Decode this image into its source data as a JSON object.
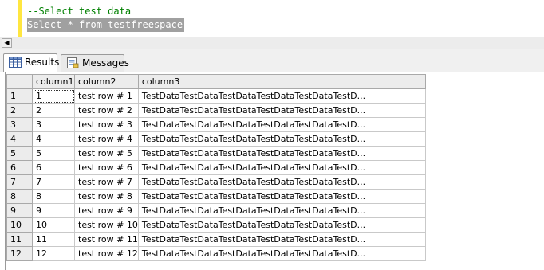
{
  "editor": {
    "comment_line": "--Select test data",
    "selected_line": "Select * from testfreespace"
  },
  "tabs": [
    {
      "label": "Results",
      "icon": "grid-icon",
      "active": true
    },
    {
      "label": "Messages",
      "icon": "messages-icon",
      "active": false
    }
  ],
  "grid": {
    "columns": [
      "column1",
      "column2",
      "column3"
    ],
    "rows": [
      [
        "1",
        "1",
        "test row # 1",
        "TestDataTestDataTestDataTestDataTestDataTestD..."
      ],
      [
        "2",
        "2",
        "test row # 2",
        "TestDataTestDataTestDataTestDataTestDataTestD..."
      ],
      [
        "3",
        "3",
        "test row # 3",
        "TestDataTestDataTestDataTestDataTestDataTestD..."
      ],
      [
        "4",
        "4",
        "test row # 4",
        "TestDataTestDataTestDataTestDataTestDataTestD..."
      ],
      [
        "5",
        "5",
        "test row # 5",
        "TestDataTestDataTestDataTestDataTestDataTestD..."
      ],
      [
        "6",
        "6",
        "test row # 6",
        "TestDataTestDataTestDataTestDataTestDataTestD..."
      ],
      [
        "7",
        "7",
        "test row # 7",
        "TestDataTestDataTestDataTestDataTestDataTestD..."
      ],
      [
        "8",
        "8",
        "test row # 8",
        "TestDataTestDataTestDataTestDataTestDataTestD..."
      ],
      [
        "9",
        "9",
        "test row # 9",
        "TestDataTestDataTestDataTestDataTestDataTestD..."
      ],
      [
        "10",
        "10",
        "test row # 10",
        "TestDataTestDataTestDataTestDataTestDataTestD..."
      ],
      [
        "11",
        "11",
        "test row # 11",
        "TestDataTestDataTestDataTestDataTestDataTestD..."
      ],
      [
        "12",
        "12",
        "test row # 12",
        "TestDataTestDataTestDataTestDataTestDataTestD..."
      ]
    ]
  },
  "colors": {
    "comment": "#008000",
    "selection_bg": "#a0a0a0",
    "change_bar": "#ffe640"
  }
}
